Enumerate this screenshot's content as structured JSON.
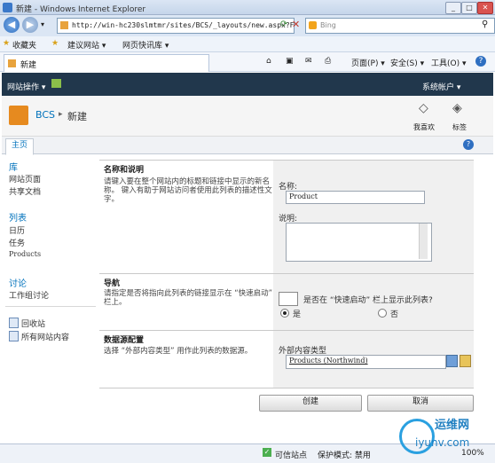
{
  "window": {
    "title": "新建 - Windows Internet Explorer",
    "buttons": [
      "_",
      "□",
      "✕"
    ]
  },
  "address": {
    "url": "http://win-hc230slmtmr/sites/BCS/_layouts/new.aspx?F",
    "search_placeholder": "Bing"
  },
  "favorites": {
    "label": "收藏夹",
    "items": [
      "建议网站 ▾",
      "网页快讯库 ▾"
    ]
  },
  "tab": {
    "title": "新建"
  },
  "commands": [
    "页面(P) ▾",
    "安全(S) ▾",
    "工具(O) ▾",
    "?"
  ],
  "sp": {
    "site_actions": "网站操作 ▾",
    "user": "系统帐户 ▾",
    "breadcrumb_site": "BCS",
    "breadcrumb_sep": "▸",
    "breadcrumb_page": "新建",
    "like": "我喜欢",
    "tags": "标签",
    "home_tab": "主页",
    "help": "?"
  },
  "leftnav": {
    "libraries": "库",
    "lib_items": [
      "网站页面",
      "共享文档"
    ],
    "lists": "列表",
    "list_items": [
      "日历",
      "任务",
      "Products"
    ],
    "discussions": "讨论",
    "disc_items": [
      "工作组讨论"
    ],
    "recycle": "回收站",
    "all_content": "所有网站内容"
  },
  "form": {
    "name_section": {
      "heading": "名称和说明",
      "desc": "请键入要在整个网站内的标题和链接中显示的新名称。 键入有助于网站访问者使用此列表的描述性文字。",
      "name_label": "名称:",
      "name_value": "Product",
      "desc_label": "说明:",
      "desc_value": ""
    },
    "nav_section": {
      "heading": "导航",
      "desc": "请指定是否将指向此列表的链接显示在 “快速启动” 栏上。",
      "question": "是否在 “快速启动” 栏上显示此列表?",
      "yes": "是",
      "no": "否"
    },
    "ds_section": {
      "heading": "数据源配置",
      "desc": "选择 “外部内容类型” 用作此列表的数据源。",
      "ect_label": "外部内容类型",
      "ect_value": "Products (Northwind)"
    },
    "create": "创建",
    "cancel": "取消"
  },
  "status": {
    "trusted": "可信站点",
    "protected": "保护模式: 禁用",
    "zoom": "100%"
  },
  "watermark": {
    "text": "运维网",
    "url": "iyunv.com"
  }
}
